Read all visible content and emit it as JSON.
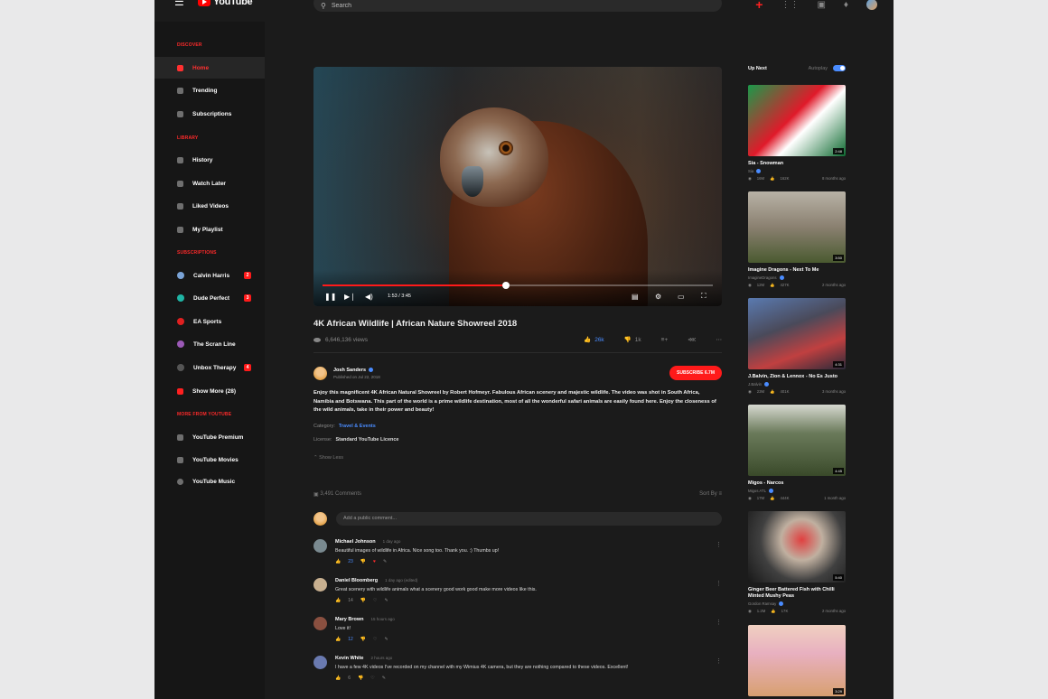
{
  "topbar": {
    "logo_text": "YouTube",
    "search_placeholder": "Search"
  },
  "sidebar": {
    "discover_header": "DISCOVER",
    "discover": [
      {
        "label": "Home"
      },
      {
        "label": "Trending"
      },
      {
        "label": "Subscriptions"
      }
    ],
    "library_header": "LIBRARY",
    "library": [
      {
        "label": "History"
      },
      {
        "label": "Watch Later"
      },
      {
        "label": "Liked Videos"
      },
      {
        "label": "My Playlist"
      }
    ],
    "subs_header": "SUBSCRIPTIONS",
    "subscriptions": [
      {
        "label": "Calvin Harris",
        "badge": "2",
        "color": "#7aa3d6"
      },
      {
        "label": "Dude Perfect",
        "badge": "3",
        "color": "#1fb5a5"
      },
      {
        "label": "EA Sports",
        "badge": "",
        "color": "#e02020"
      },
      {
        "label": "The Scran Line",
        "badge": "",
        "color": "#9b59b6"
      },
      {
        "label": "Unbox Therapy",
        "badge": "4",
        "color": "#555555"
      },
      {
        "label": "Show More (28)",
        "badge": "",
        "color": "#ff2020"
      }
    ],
    "more_header": "MORE FROM YOUTUBE",
    "more": [
      {
        "label": "YouTube Premium"
      },
      {
        "label": "YouTube Movies"
      },
      {
        "label": "YouTube Music"
      }
    ]
  },
  "video": {
    "title": "4K African Wildlife | African Nature Showreel 2018",
    "views": "6,646,136 views",
    "time": "1:53 / 3:45",
    "progress": 0.47,
    "likes": "26k",
    "dislikes": "1k"
  },
  "channel": {
    "name": "Josh Sanders",
    "published": "Published on Jul 22, 2018",
    "subscribe": "SUBSCRIBE 6.7M"
  },
  "description": "Enjoy this magnificent 4K African Natural Showreel by Robert Hofmeyr. Fabulous African scenery and majestic wildlife. The video was shot in South Africa, Namibia and Botswana. This part of the world is a prime wildlife destination, most of all the wonderful safari animals are easily found here. Enjoy the closeness of the wild animals, take in their power and beauty!",
  "category_label": "Category:",
  "category": "Travel & Events",
  "license_label": "License:",
  "license": "Standard YouTube Licence",
  "show_less": "Show Less",
  "comments": {
    "count": "3,491 Comments",
    "sort": "Sort By",
    "placeholder": "Add a public comment...",
    "items": [
      {
        "name": "Michael Johnson",
        "time": "1 day ago",
        "text": "Beautiful images of wildlife in Africa. Nice song too. Thank you. :) Thumbs up!",
        "likes": "23",
        "avatar": "#7a8a90"
      },
      {
        "name": "Daniel Bloomberg",
        "time": "1 day ago (edited)",
        "text": "Great scenery with wildlife animals what a scenery good work good make more videos like this.",
        "likes": "14",
        "avatar": "#c8b090"
      },
      {
        "name": "Mary Brown",
        "time": "15 hours ago",
        "text": "Love it!",
        "likes": "12",
        "avatar": "#8a5040"
      },
      {
        "name": "Kevin White",
        "time": "2 hours ago",
        "text": "I have a few 4K videos I've recorded on my channel with my Wimius 4K camera, but they are nothing compared to these videos. Excellent!",
        "likes": "6",
        "avatar": "#6a7ab0"
      }
    ]
  },
  "upnext": {
    "title": "Up Next",
    "autoplay": "Autoplay",
    "items": [
      {
        "title": "Sia - Snowman",
        "channel": "Sia",
        "views": "16M",
        "likes": "162K",
        "ago": "8 months ago",
        "duration": "2:48",
        "bg": "linear-gradient(135deg,#1a9a4a 0%,#e01a2a 45%,#ffffff 60%,#0d6a30 100%)"
      },
      {
        "title": "Imagine Dragons - Next To Me",
        "channel": "ImagineDragons",
        "views": "12M",
        "likes": "427K",
        "ago": "2 months ago",
        "duration": "3:50",
        "bg": "linear-gradient(180deg,#b8b2a6 0%,#8a8070 50%,#4a5a30 100%)"
      },
      {
        "title": "J.Balvin, Zion & Lennox - No Es Justo",
        "channel": "J.Balvin",
        "views": "23M",
        "likes": "401K",
        "ago": "3 months ago",
        "duration": "4:31",
        "bg": "linear-gradient(160deg,#5a7ab0 0%,#4a4a5a 40%,#c04040 70%,#2a2a3a 100%)"
      },
      {
        "title": "Migos - Narcos",
        "channel": "Migos ATL",
        "views": "17M",
        "likes": "444K",
        "ago": "1 month ago",
        "duration": "4:45",
        "bg": "linear-gradient(180deg,#d6d8d0 0%,#6a7a5a 40%,#3a4a2a 100%)"
      },
      {
        "title": "Ginger Beer Battered Fish with Chilli Minted Mushy Peas",
        "channel": "Gordon Ramsay",
        "views": "1.2M",
        "likes": "17K",
        "ago": "2 months ago",
        "duration": "5:40",
        "bg": "radial-gradient(circle at 55% 40%,#e04040 0%,#c0b0a0 30%,#404040 60%,#181818 100%)"
      },
      {
        "title": "",
        "channel": "",
        "views": "",
        "likes": "",
        "ago": "",
        "duration": "3:29",
        "bg": "linear-gradient(180deg,#f0d0c0 0%,#e8b0c0 40%,#d8a070 100%)"
      }
    ]
  }
}
